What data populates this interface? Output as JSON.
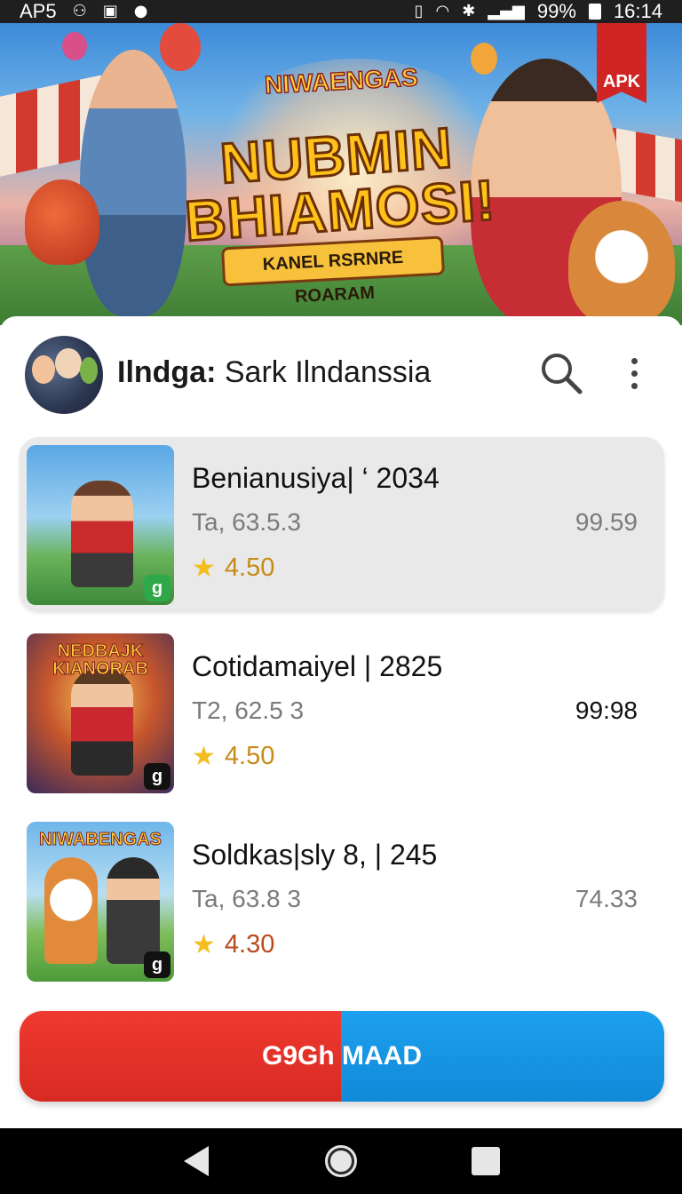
{
  "status_bar": {
    "carrier": "AP5",
    "battery": "99%",
    "time": "16:14"
  },
  "banner": {
    "small_logo": "NIWAENGAS",
    "headline": "NUBMIN BHIAMOSI!",
    "subline": "KANEL RSRNRE ROARAM",
    "badge": "APK"
  },
  "header": {
    "title_bold": "Ilndga:",
    "title_rest": " Sark Ilndanssia"
  },
  "items": [
    {
      "title": "Benianusiya| ‘ 2034",
      "meta": "Ta, 63.5.3",
      "price": "99.59",
      "rating": "4.50",
      "selected": true,
      "badge": "g"
    },
    {
      "title": "Cotidamaiyel | 2825",
      "meta": "T2, 62.5 3",
      "price": "99:98",
      "rating": "4.50",
      "thumb_title": "NEDBAJK KIANORAB",
      "badge": "g"
    },
    {
      "title": "Soldkas|sly 8, | 245",
      "meta": "Ta, 63.8 3",
      "price": "74.33",
      "rating": "4.30",
      "thumb_title": "NIWABENGAS",
      "badge": "g"
    }
  ],
  "cta": {
    "label": "G9Gh MAAD"
  },
  "colors": {
    "cta_left": "#e0302a",
    "cta_right": "#1596e4",
    "rating": "#c78a16",
    "selected_bg": "#e9e9ea"
  }
}
